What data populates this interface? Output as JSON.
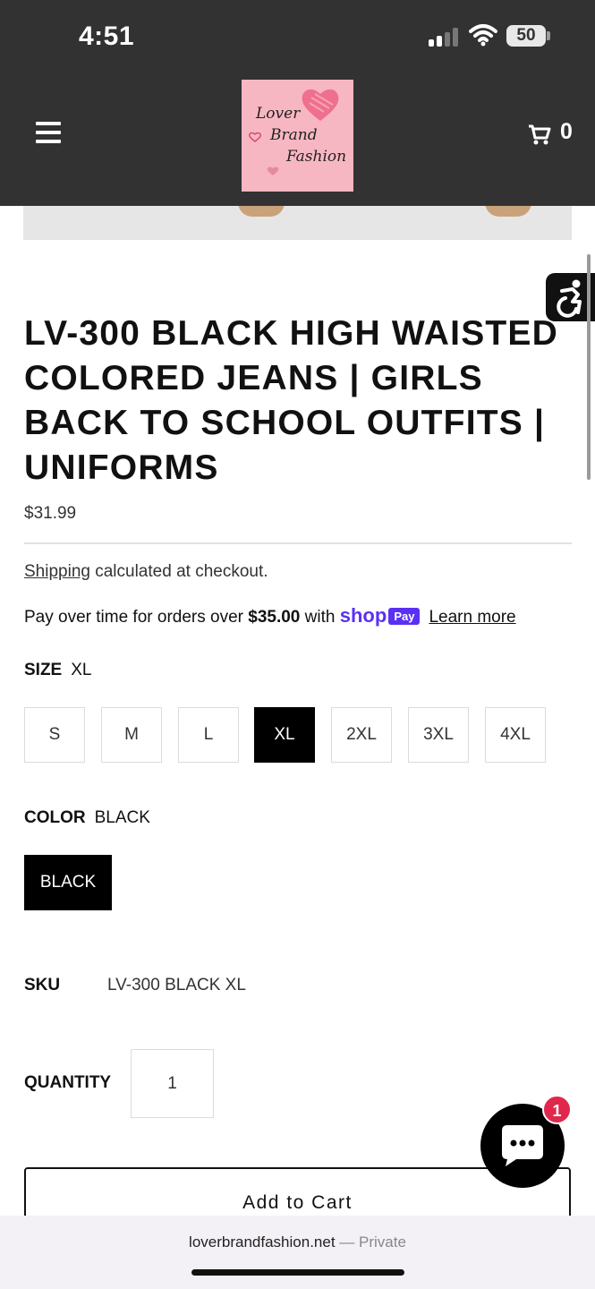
{
  "status_bar": {
    "time": "4:51",
    "battery": "50"
  },
  "header": {
    "logo": {
      "line1": "Lover",
      "line2": "Brand",
      "line3": "Fashion"
    },
    "cart_count": "0"
  },
  "product": {
    "title": "LV-300 BLACK HIGH WAISTED COLORED JEANS | GIRLS BACK TO SCHOOL OUTFITS | UNIFORMS",
    "price": "$31.99",
    "shipping_link": "Shipping",
    "shipping_text": " calculated at checkout.",
    "installments": {
      "prefix": "Pay over time for orders over ",
      "amount": "$35.00",
      "suffix": " with ",
      "shop_word": "shop",
      "pay_badge": "Pay",
      "learn_more": "Learn more"
    },
    "size": {
      "label": "SIZE",
      "selected": "XL",
      "options": [
        "S",
        "M",
        "L",
        "XL",
        "2XL",
        "3XL",
        "4XL"
      ]
    },
    "color": {
      "label": "COLOR",
      "selected": "BLACK",
      "options": [
        "BLACK"
      ]
    },
    "sku": {
      "label": "SKU",
      "value": "LV-300 BLACK XL"
    },
    "quantity": {
      "label": "QUANTITY",
      "value": "1"
    },
    "add_to_cart": "Add to Cart"
  },
  "chat": {
    "badge": "1"
  },
  "browser": {
    "domain": "loverbrandfashion.net",
    "separator": " — ",
    "mode": "Private"
  },
  "colors": {
    "header_bg": "#323232",
    "logo_bg": "#f7b7c2",
    "shop_pay": "#5a31f4",
    "chat_badge": "#e0284c"
  }
}
